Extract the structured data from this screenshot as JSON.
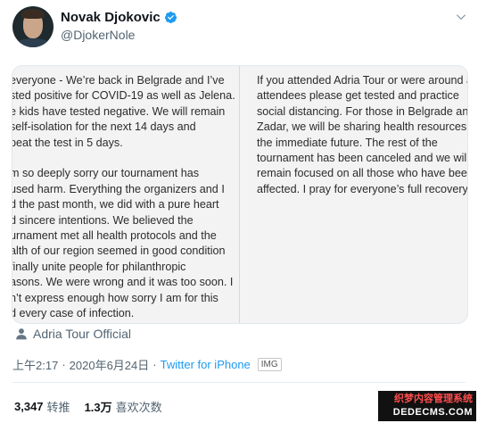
{
  "author": {
    "name": "Novak Djokovic",
    "handle": "@DjokerNole"
  },
  "media": {
    "left_text": "everyone - We’re back in Belgrade and I’ve\nsted positive for COVID-19 as well as Jelena.\ne kids have tested negative. We will remain\nself-isolation for the next 14 days and\npeat the test in 5 days.\n\nm so deeply sorry our tournament has\nused harm. Everything the organizers and I\nd the past month, we did with a pure heart\nd sincere intentions. We believed the\nurnament met all health protocols and the\nalth of our region seemed in good condition\nfinally unite people for philanthropic\nasons. We were wrong and it was too soon. I\nn’t express enough how sorry I am for this\nd every case of infection.",
    "right_text": "If you attended Adria Tour or were around an\nattendees please get tested and practice\nsocial distancing. For those in Belgrade and\nZadar, we will be sharing health resources in\nthe immediate future. The rest of the\ntournament has been canceled and we will\nremain focused on all those who have been\naffected. I pray for everyone’s full recovery."
  },
  "location": "Adria Tour Official",
  "meta": {
    "time": "上午2:17",
    "separator": "·",
    "date": "2020年6月24日",
    "source": "Twitter for iPhone",
    "badge": "IMG"
  },
  "stats": {
    "retweets_count": "3,347",
    "retweets_label": "转推",
    "likes_count": "1.3万",
    "likes_label": "喜欢次数"
  },
  "watermark": {
    "line1": "织梦内容管理系统",
    "line2": "DEDECMS.COM"
  },
  "colors": {
    "accent": "#1d9bf0",
    "secondary_text": "#536471"
  },
  "icons": [
    "verified-icon",
    "chevron-down-icon",
    "person-icon"
  ]
}
